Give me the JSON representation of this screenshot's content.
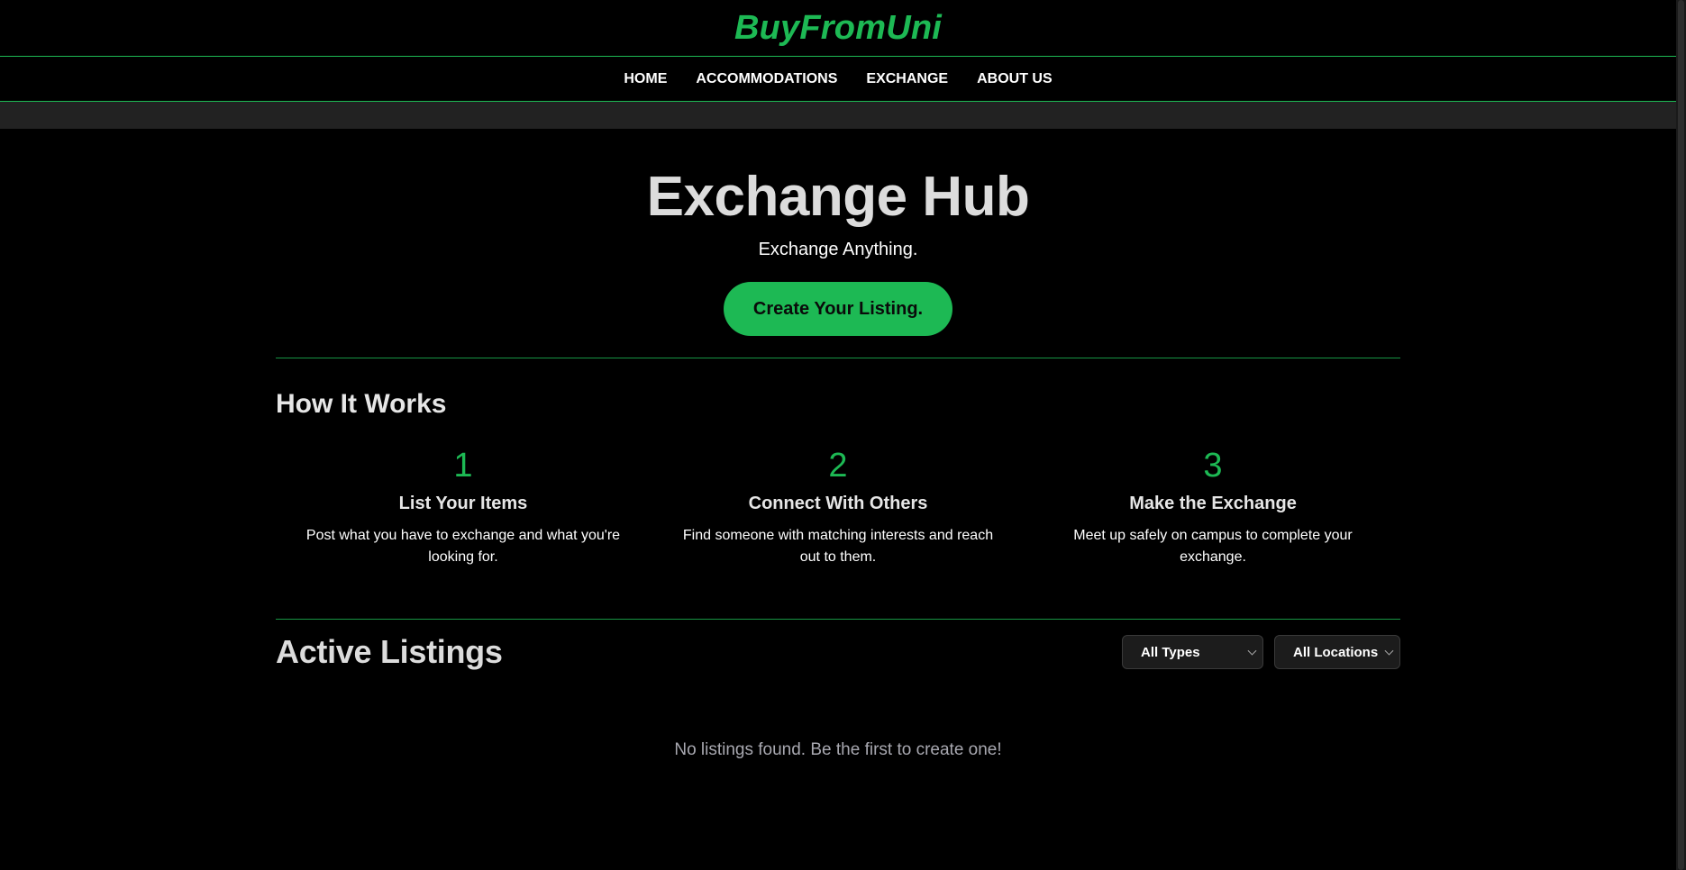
{
  "header": {
    "brand": "BuyFromUni",
    "nav": [
      {
        "label": "HOME"
      },
      {
        "label": "ACCOMMODATIONS"
      },
      {
        "label": "EXCHANGE"
      },
      {
        "label": "ABOUT US"
      }
    ]
  },
  "hero": {
    "title": "Exchange Hub",
    "subtitle": "Exchange Anything.",
    "cta_label": "Create Your Listing."
  },
  "how_it_works": {
    "title": "How It Works",
    "steps": [
      {
        "number": "1",
        "title": "List Your Items",
        "description": "Post what you have to exchange and what you're looking for."
      },
      {
        "number": "2",
        "title": "Connect With Others",
        "description": "Find someone with matching interests and reach out to them."
      },
      {
        "number": "3",
        "title": "Make the Exchange",
        "description": "Meet up safely on campus to complete your exchange."
      }
    ]
  },
  "listings": {
    "title": "Active Listings",
    "filters": {
      "type": {
        "selected": "All Types"
      },
      "location": {
        "selected": "All Locations"
      }
    },
    "empty_message": "No listings found. Be the first to create one!"
  },
  "colors": {
    "accent": "#1db954",
    "background": "#000000",
    "strip": "#222222"
  }
}
